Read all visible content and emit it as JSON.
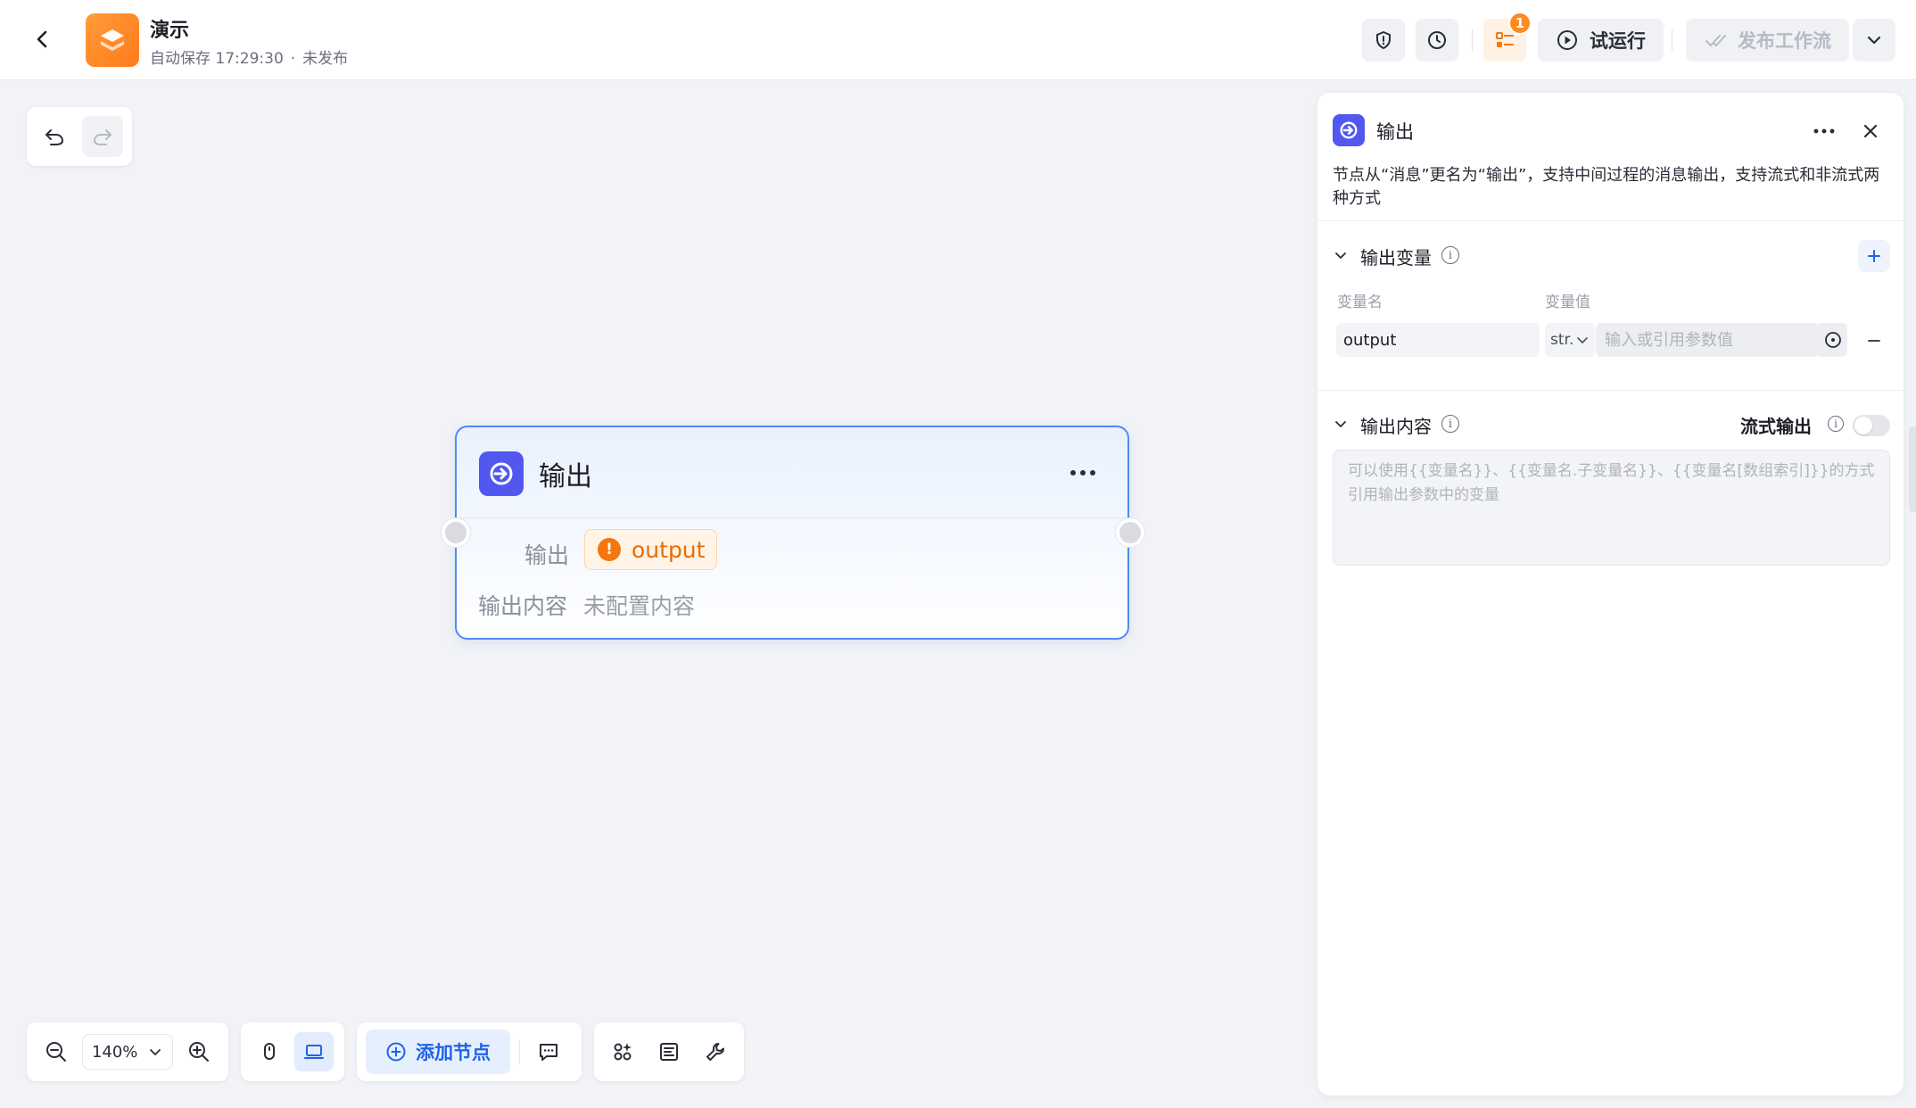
{
  "header": {
    "title": "演示",
    "autosave_label": "自动保存",
    "autosave_time": "17:29:30",
    "separator": "·",
    "publish_status": "未发布",
    "badge_count": "1",
    "test_run_label": "试运行",
    "publish_label": "发布工作流"
  },
  "node": {
    "title": "输出",
    "row_output_label": "输出",
    "output_tag": "output",
    "row_content_label": "输出内容",
    "row_content_value": "未配置内容"
  },
  "toolbar": {
    "zoom_level": "140%",
    "add_node_label": "添加节点"
  },
  "panel": {
    "title": "输出",
    "description": "节点从“消息”更名为“输出”，支持中间过程的消息输出，支持流式和非流式两种方式",
    "output_vars_title": "输出变量",
    "col_var_name": "变量名",
    "col_var_value": "变量值",
    "var_name": "output",
    "var_type": "str.",
    "var_value_placeholder": "输入或引用参数值",
    "output_content_title": "输出内容",
    "stream_output_label": "流式输出",
    "content_placeholder": "可以使用{{变量名}}、{{变量名.子变量名}}、{{变量名[数组索引]}}的方式引用输出参数中的变量"
  },
  "colors": {
    "accent": "#1f63e9",
    "node_border": "#4d8cf0",
    "node_icon": "#5257f0",
    "warning": "#f5750f",
    "logo": "#ff8a2a"
  }
}
